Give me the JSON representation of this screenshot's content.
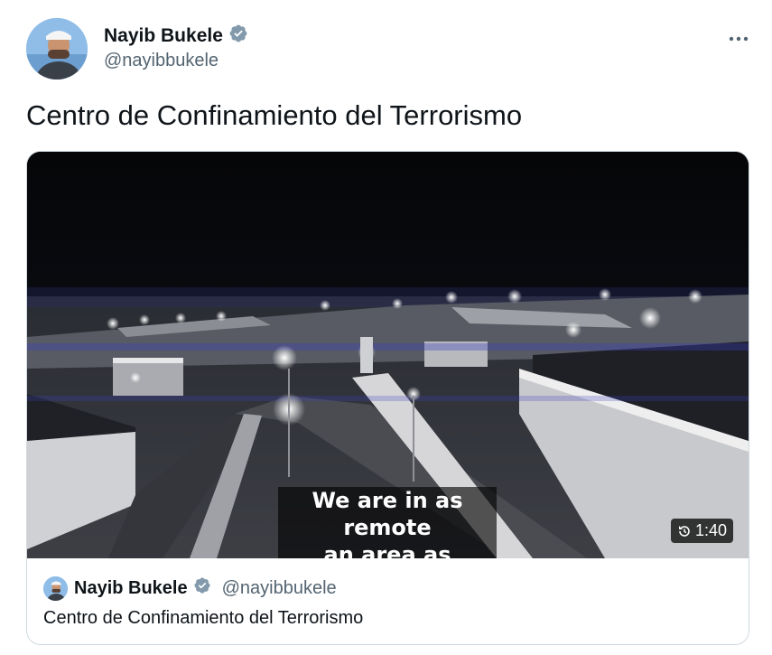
{
  "author": {
    "name": "Nayib Bukele",
    "handle": "@nayibbukele",
    "verified": true,
    "badge_color": "#829aab"
  },
  "tweet": {
    "text": "Centro de Confinamiento del Terrorismo"
  },
  "media": {
    "caption_line1": "We are in as remote",
    "caption_line2": "an area as possible.",
    "duration": "1:40"
  },
  "quote": {
    "name": "Nayib Bukele",
    "handle": "@nayibbukele",
    "text": "Centro de Confinamiento del Terrorismo"
  },
  "icons": {
    "more": "more-icon",
    "verified": "verified-badge-icon",
    "replay": "replay-icon"
  },
  "colors": {
    "text_primary": "#0f1419",
    "text_secondary": "#536471",
    "border": "#cfd9de"
  }
}
